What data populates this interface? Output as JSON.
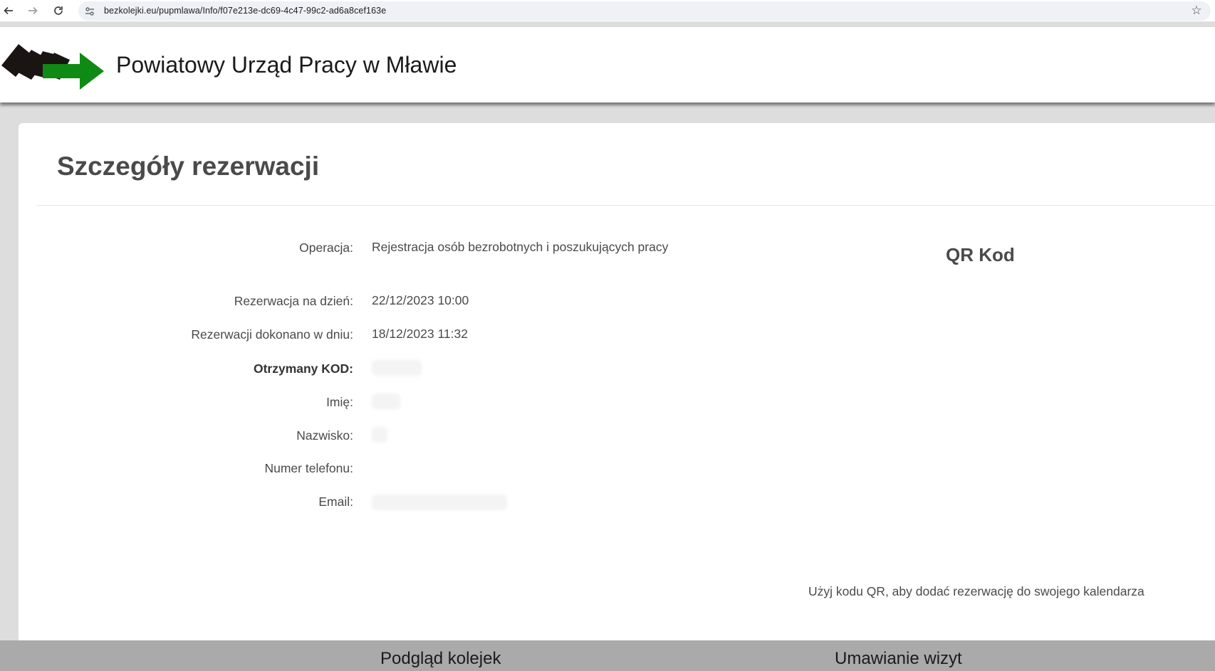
{
  "browser": {
    "url": "bezkolejki.eu/pupmlawa/Info/f07e213e-dc69-4c47-99c2-ad6a8cef163e",
    "back_icon": "arrow-left-icon",
    "forward_icon": "arrow-right-icon",
    "reload_icon": "reload-icon",
    "site_info_icon": "tune-icon",
    "bookmark_icon": "star-icon"
  },
  "header": {
    "title": "Powiatowy Urząd Pracy w Mławie",
    "logo_colors": {
      "cards": "#1a1413",
      "arrow": "#0f8a14"
    }
  },
  "card": {
    "title": "Szczegóły rezerwacji",
    "details": [
      {
        "label": "Operacja:",
        "value": "Rejestracja osób bezrobotnych i poszukujących pracy"
      },
      {
        "label": "Rezerwacja na dzień:",
        "value": "22/12/2023 10:00"
      },
      {
        "label": "Rezerwacji dokonano w dniu:",
        "value": "18/12/2023 11:32"
      },
      {
        "label": "Otrzymany KOD:",
        "value": ""
      },
      {
        "label": "Imię:",
        "value": ""
      },
      {
        "label": "Nazwisko:",
        "value": ""
      },
      {
        "label": "Numer telefonu:",
        "value": ""
      },
      {
        "label": "Email:",
        "value": ""
      }
    ],
    "qr_title": "QR Kod",
    "qr_hint": "Użyj kodu QR, aby dodać rezerwację do swojego kalendarza"
  },
  "footer": {
    "links": [
      "Podgląd kolejek",
      "Umawianie wizyt"
    ]
  }
}
